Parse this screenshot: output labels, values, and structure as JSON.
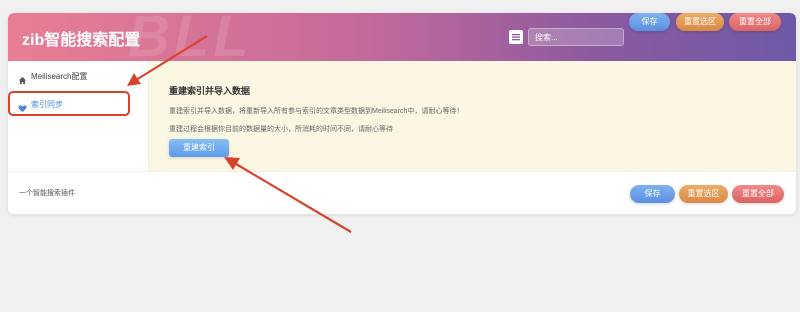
{
  "header": {
    "title": "zib智能搜索配置",
    "watermark": "BLL",
    "search_placeholder": "搜索...",
    "save_label": "保存",
    "reset_selection_label": "重置选区",
    "reset_all_label": "重置全部"
  },
  "sidebar": {
    "items": [
      {
        "label": "Meilisearch配置",
        "icon": "home-icon",
        "active": false
      },
      {
        "label": "索引同步",
        "icon": "heart-icon",
        "active": true
      }
    ]
  },
  "main": {
    "section_title": "重建索引并导入数据",
    "description_1": "重建索引并导入数据，将重新导入所有参与索引的文章类型数据到Meilisearch中，请耐心等待！",
    "description_2": "重建过程会根据你目前的数据量的大小，所消耗的时间不同，请耐心等待",
    "rebuild_button_label": "重建索引"
  },
  "footer": {
    "plugin_text": "一个智能搜索插件",
    "save_label": "保存",
    "reset_selection_label": "重置选区",
    "reset_all_label": "重置全部"
  },
  "colors": {
    "header_gradient_start": "#e97e93",
    "header_gradient_end": "#6e59a8",
    "annotation_red": "#d8432e",
    "save_blue": "#5b8fe0",
    "reset_selection_orange": "#d98a45",
    "reset_all_red": "#dd6262",
    "content_background": "#fbf7e3"
  }
}
